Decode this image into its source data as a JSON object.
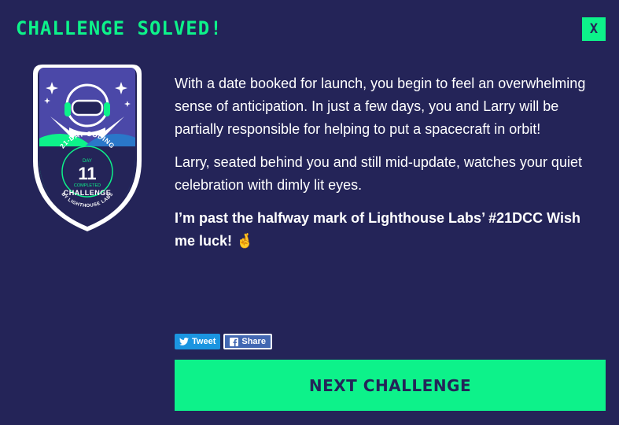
{
  "modal": {
    "title": "CHALLENGE SOLVED!",
    "close_label": "X"
  },
  "badge": {
    "arc_top": "21-DAY CODING",
    "day_label": "DAY",
    "day_number": "11",
    "completed_label": "COMPLETED",
    "challenge_label": "CHALLENGE",
    "org_label": "BY LIGHTHOUSE LABS",
    "icon": "astronaut-helmet-badge"
  },
  "story": {
    "paragraph_1": "With a date booked for launch, you begin to feel an overwhelming sense of anticipation. In just a few days, you and Larry will be partially responsible for helping to put a spacecraft in orbit!",
    "paragraph_2": "Larry, seated behind you and still mid-update, watches your quiet celebration with dimly lit eyes.",
    "share_text": "I’m past the halfway mark of Lighthouse Labs’ #21DCC Wish me luck! 🤞"
  },
  "share": {
    "tweet_label": "Tweet",
    "facebook_label": "Share"
  },
  "actions": {
    "next_label": "NEXT CHALLENGE"
  },
  "colors": {
    "background": "#242458",
    "accent": "#0df28a",
    "twitter": "#1b95e0",
    "facebook": "#4267b2"
  }
}
